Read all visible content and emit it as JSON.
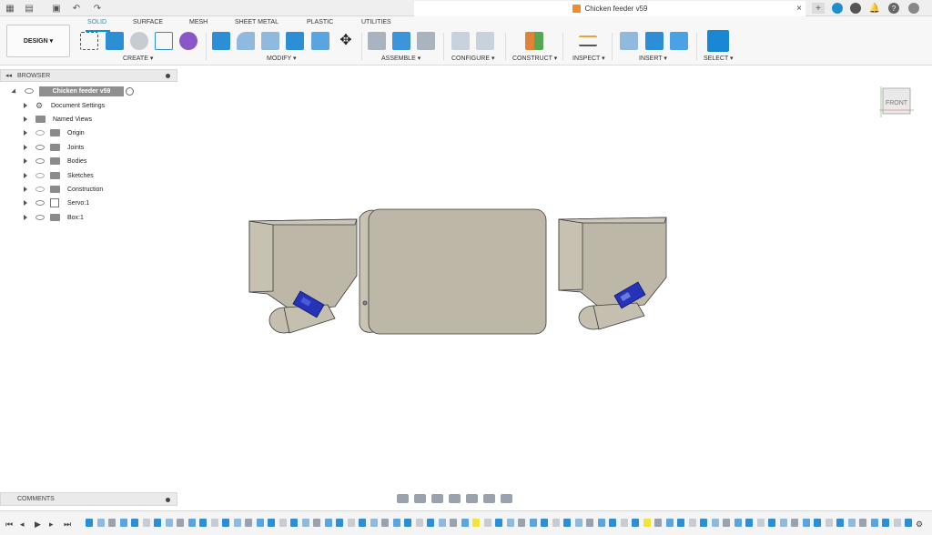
{
  "titlebar": {
    "document_title": "Chicken feeder v59",
    "close_label": "×",
    "add_label": "+"
  },
  "toolbar": {
    "workspace": "DESIGN",
    "tabs": [
      "SOLID",
      "SURFACE",
      "MESH",
      "SHEET METAL",
      "PLASTIC",
      "UTILITIES"
    ],
    "active_tab": "SOLID",
    "groups": [
      "CREATE",
      "MODIFY",
      "ASSEMBLE",
      "CONFIGURE",
      "CONSTRUCT",
      "INSPECT",
      "INSERT",
      "SELECT"
    ]
  },
  "browser": {
    "title": "BROWSER",
    "root": "Chicken feeder v59",
    "items": [
      "Document Settings",
      "Named Views",
      "Origin",
      "Joints",
      "Bodies",
      "Sketches",
      "Construction",
      "Servo:1",
      "Box:1"
    ]
  },
  "viewcube": {
    "face": "FRONT"
  },
  "comments": {
    "title": "COMMENTS"
  },
  "colors": {
    "accent": "#0696d7",
    "part": "#bdb7a7",
    "servo": "#2433b8"
  }
}
